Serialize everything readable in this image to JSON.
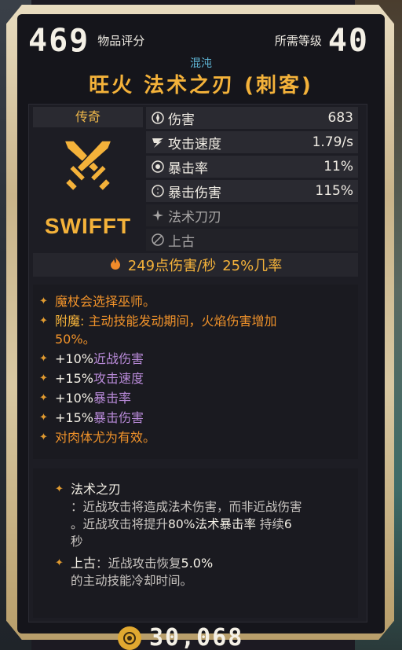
{
  "header": {
    "item_score": "469",
    "item_score_label": "物品评分",
    "required_level_label": "所需等级",
    "required_level": "40"
  },
  "item": {
    "rarity_tag": "混沌",
    "name": "旺火 法术之刃 (刺客)",
    "tier": "传奇",
    "brand": "SWIFFT"
  },
  "stats": [
    {
      "icon": "damage-icon",
      "name": "伤害",
      "value": "683"
    },
    {
      "icon": "attack-speed-icon",
      "name": "攻击速度",
      "value": "1.79/s"
    },
    {
      "icon": "crit-rate-icon",
      "name": "暴击率",
      "value": "11%"
    },
    {
      "icon": "crit-damage-icon",
      "name": "暴击伤害",
      "value": "115%"
    },
    {
      "icon": "spell-blade-icon",
      "name": "法术刀刃",
      "value": ""
    },
    {
      "icon": "ancient-icon",
      "name": "上古",
      "value": ""
    }
  ],
  "dps": {
    "icon": "fire-icon",
    "text": "249点伤害/秒",
    "chance": "25%几率"
  },
  "affixes": {
    "class": "魔杖会选择巫师。",
    "enchant_label": "附魔",
    "enchant_text": "主动技能发动期间，火焰伤害增加",
    "enchant_value": "50%。",
    "bonus_1_value": "+10%",
    "bonus_1_name": "近战伤害",
    "bonus_2_value": "+15%",
    "bonus_2_name": "攻击速度",
    "bonus_3_value": "+10%",
    "bonus_3_name": "暴击率",
    "bonus_4_value": "+15%",
    "bonus_4_name": "暴击伤害",
    "flesh": "对肉体尤为有效。"
  },
  "abilities": {
    "spellblade_title": "法术之刃",
    "spellblade_line1": "：近战攻击将造成法术伤害，而非近战伤害",
    "spellblade_line2_a": "。近战攻击将提升",
    "spellblade_line2_b": "80%法术暴击率",
    "spellblade_line2_c": " 持续",
    "spellblade_line2_d": "6",
    "spellblade_line3": "秒",
    "ancient_title": "上古",
    "ancient_text_a": "：近战攻击恢复",
    "ancient_text_b": "5.0%",
    "ancient_line2": "的主动技能冷却时间。"
  },
  "footer": {
    "price": "30,068"
  },
  "colors": {
    "title_gold": "#f4b23a",
    "rarity_blue": "#5fb6d6",
    "affix_orange": "#f0922a",
    "accent_amber": "#e09a30"
  }
}
